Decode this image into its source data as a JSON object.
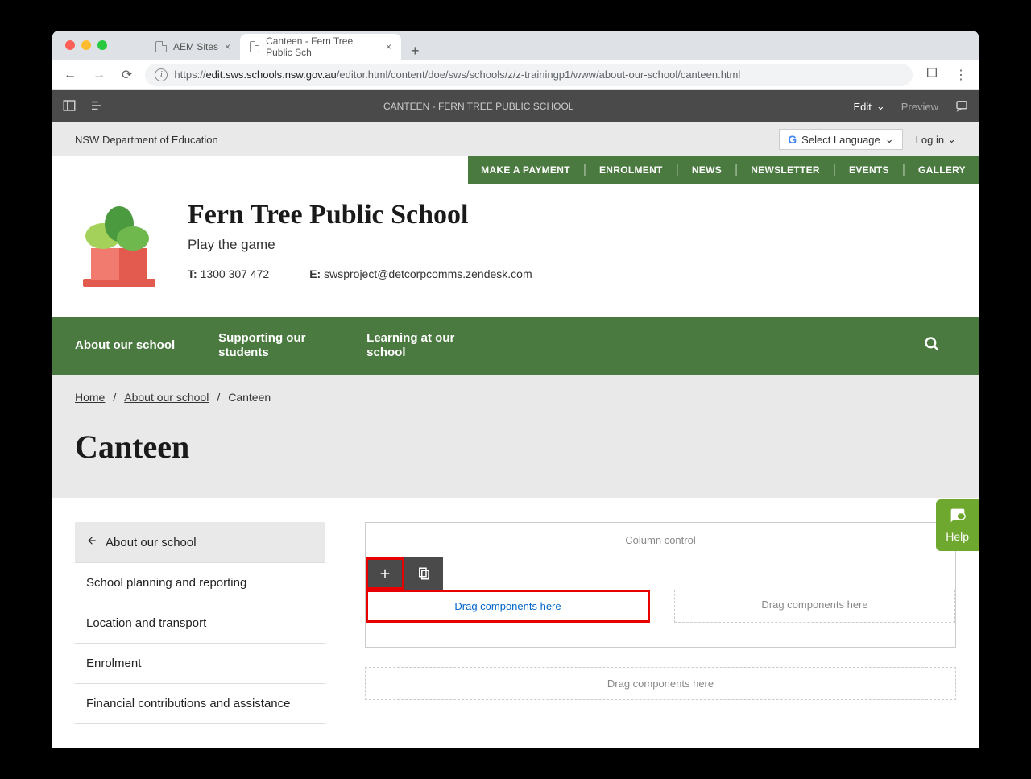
{
  "browser": {
    "tabs": [
      {
        "title": "AEM Sites",
        "active": false
      },
      {
        "title": "Canteen - Fern Tree Public Sch",
        "active": true
      }
    ],
    "url_prefix": "https://",
    "url_bold": "edit.sws.schools.nsw.gov.au",
    "url_rest": "/editor.html/content/doe/sws/schools/z/z-trainingp1/www/about-our-school/canteen.html"
  },
  "aem": {
    "title": "CANTEEN - FERN TREE PUBLIC SCHOOL",
    "edit": "Edit",
    "preview": "Preview"
  },
  "dept": {
    "name": "NSW Department of Education",
    "lang": "Select Language",
    "login": "Log in"
  },
  "topnav": {
    "items": [
      "MAKE A PAYMENT",
      "ENROLMENT",
      "NEWS",
      "NEWSLETTER",
      "EVENTS",
      "GALLERY"
    ]
  },
  "school": {
    "name": "Fern Tree Public School",
    "tagline": "Play the game",
    "phone_label": "T:",
    "phone": "1300 307 472",
    "email_label": "E:",
    "email": "swsproject@detcorpcomms.zendesk.com"
  },
  "mainnav": {
    "items": [
      "About our school",
      "Supporting our students",
      "Learning at our school"
    ]
  },
  "breadcrumb": {
    "items": [
      "Home",
      "About our school"
    ],
    "current": "Canteen"
  },
  "page": {
    "title": "Canteen"
  },
  "sidebar": {
    "active": "About our school",
    "items": [
      "School planning and reporting",
      "Location and transport",
      "Enrolment",
      "Financial contributions and assistance"
    ]
  },
  "editor": {
    "column_control": "Column control",
    "drag_here": "Drag components here"
  },
  "help": {
    "label": "Help"
  }
}
